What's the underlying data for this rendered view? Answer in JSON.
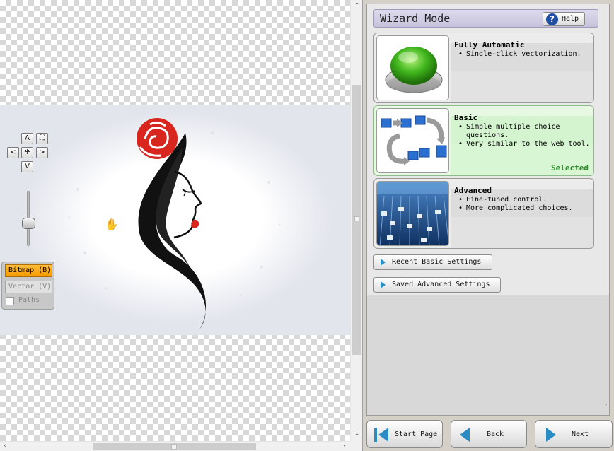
{
  "canvas": {
    "mode_buttons": {
      "bitmap": "Bitmap (B)",
      "vector": "Vector (V)",
      "paths": "Paths"
    },
    "nav_glyphs": {
      "up": "Λ",
      "down": "V",
      "left": "<",
      "right": ">",
      "center": "⁜",
      "fit": "⛶"
    },
    "zoom_level": 0.5
  },
  "wizard": {
    "title": "Wizard Mode",
    "help": "Help",
    "options": [
      {
        "title": "Fully Automatic",
        "bullets": [
          "Single-click vectorization."
        ],
        "selected": false
      },
      {
        "title": "Basic",
        "bullets": [
          "Simple multiple choice questions.",
          "Very similar to the web tool."
        ],
        "selected": true,
        "selected_label": "Selected"
      },
      {
        "title": "Advanced",
        "bullets": [
          "Fine-tuned control.",
          "More complicated choices."
        ],
        "selected": false
      }
    ],
    "settings_buttons": [
      "Recent Basic Settings",
      "Saved Advanced Settings"
    ],
    "footer": {
      "start": "Start Page",
      "back": "Back",
      "next": "Next"
    }
  },
  "colors": {
    "accent": "#f39a00",
    "selected_green": "#2c8a2c",
    "title_bar": "#c5c2dc",
    "nav_blue": "#2a8cc4"
  }
}
